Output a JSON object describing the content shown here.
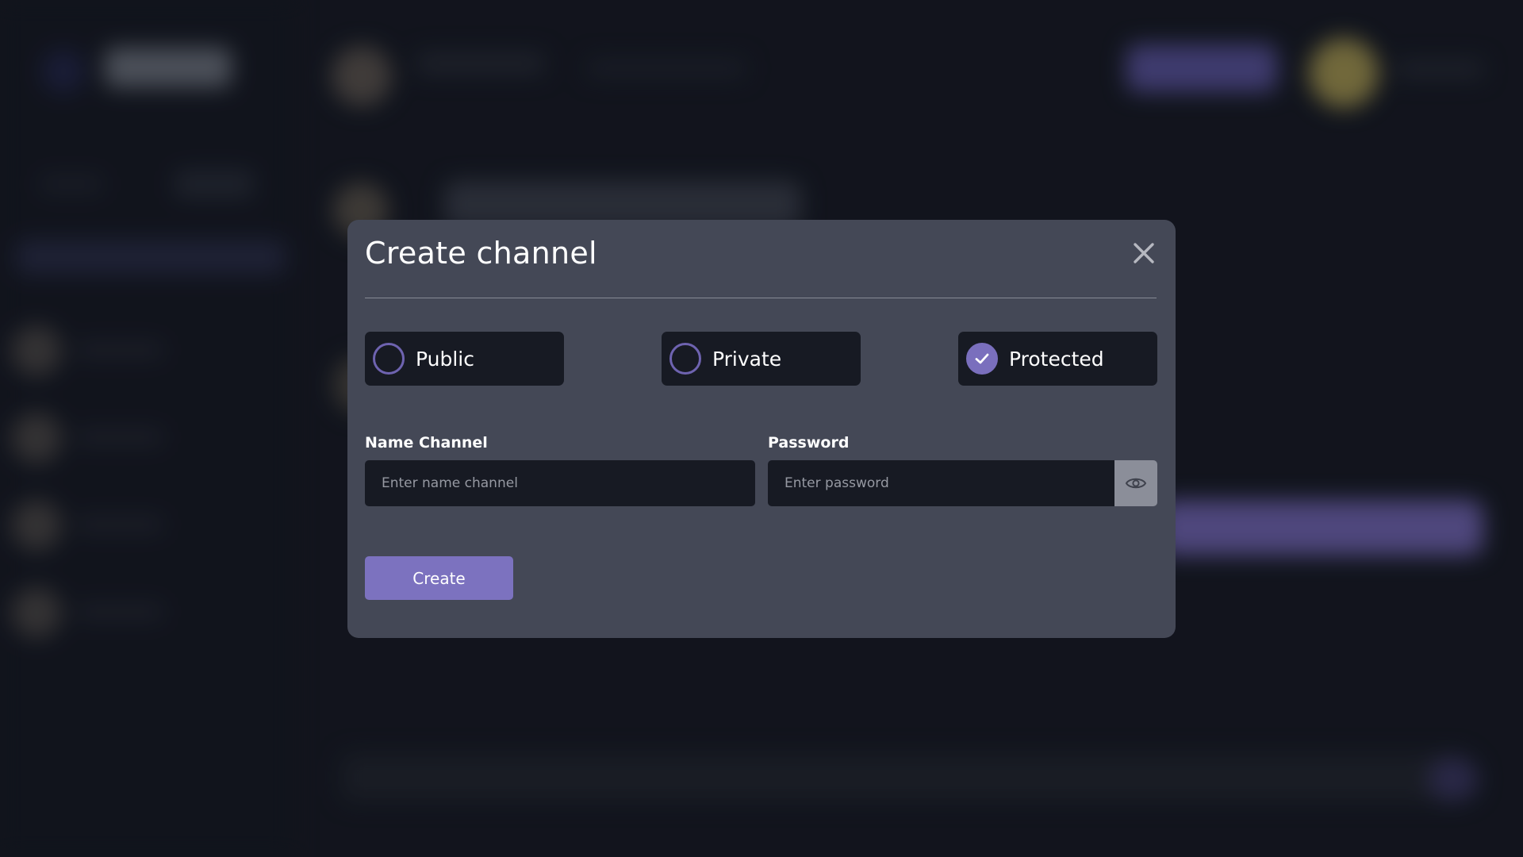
{
  "modal": {
    "title": "Create channel",
    "options": [
      {
        "label": "Public",
        "checked": false
      },
      {
        "label": "Private",
        "checked": false
      },
      {
        "label": "Protected",
        "checked": true
      }
    ],
    "name_field": {
      "label": "Name Channel",
      "placeholder": "Enter name channel",
      "value": ""
    },
    "password_field": {
      "label": "Password",
      "placeholder": "Enter password",
      "value": ""
    },
    "create_label": "Create"
  },
  "colors": {
    "modal_bg": "#444856",
    "accent": "#7c72bf",
    "input_bg": "#171a23",
    "page_bg": "#171a24"
  },
  "icons": {
    "close": "close-icon",
    "check": "check-icon",
    "eye": "eye-icon"
  }
}
